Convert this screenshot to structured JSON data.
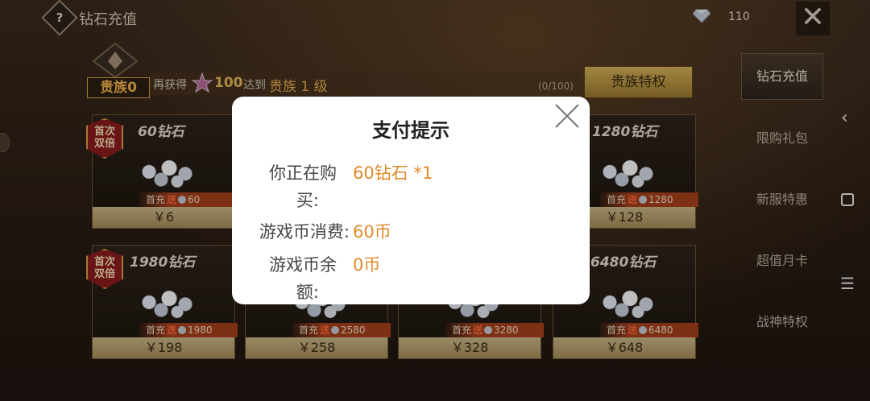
{
  "topbar": {
    "help_icon": "?",
    "title": "钻石充值",
    "gem_count": "110",
    "close_icon": "✕"
  },
  "noble": {
    "level_label": "贵族0",
    "get_text": "再获得",
    "points": "100",
    "reach_text": "达到",
    "target_level": "贵族 1 级",
    "progress": "(0/100)",
    "privilege_button": "贵族特权"
  },
  "tabs": [
    {
      "label": "钻石充值"
    },
    {
      "label": "限购礼包"
    },
    {
      "label": "新服特惠"
    },
    {
      "label": "超值月卡"
    },
    {
      "label": "战神特权"
    }
  ],
  "cards": [
    {
      "amount": "60钻石",
      "first_charge": "首充",
      "send": "送",
      "bonus": "60",
      "price": "￥6",
      "badge_line1": "首次",
      "badge_line2": "双倍"
    },
    {
      "amount": "1280钻石",
      "first_charge": "首充",
      "send": "送",
      "bonus": "1280",
      "price": "￥128"
    },
    {
      "amount": "1980钻石",
      "first_charge": "首充",
      "send": "送",
      "bonus": "1980",
      "price": "￥198",
      "badge_line1": "首次",
      "badge_line2": "双倍"
    },
    {
      "first_charge": "首充",
      "send": "送",
      "bonus": "2580",
      "price": "￥258"
    },
    {
      "first_charge": "首充",
      "send": "送",
      "bonus": "3280",
      "price": "￥328"
    },
    {
      "amount": "6480钻石",
      "first_charge": "首充",
      "send": "送",
      "bonus": "6480",
      "price": "￥648"
    }
  ],
  "modal": {
    "title": "支付提示",
    "rows": [
      {
        "label_line1": "你正在购",
        "label_line2": "买:",
        "value": "60钻石 *1"
      },
      {
        "label": "游戏币消费:",
        "value": "60币"
      },
      {
        "label_line1": "游戏币余",
        "label_line2": "额:",
        "value": "0币"
      }
    ]
  },
  "android_nav": {
    "back": "‹",
    "menu": "☰"
  }
}
